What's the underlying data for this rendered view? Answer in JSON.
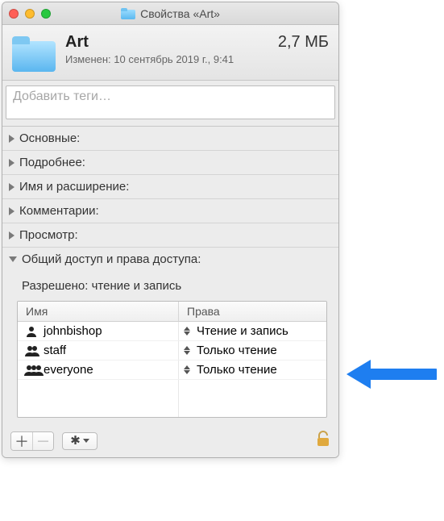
{
  "window": {
    "title": "Свойства «Art»"
  },
  "header": {
    "name": "Art",
    "size": "2,7 МБ",
    "modified": "Изменен: 10 сентябрь 2019 г., 9:41"
  },
  "tags": {
    "placeholder": "Добавить теги…"
  },
  "sections": {
    "general": "Основные:",
    "more": "Подробнее:",
    "name_ext": "Имя и расширение:",
    "comments": "Комментарии:",
    "preview": "Просмотр:",
    "sharing": "Общий доступ и права доступа:"
  },
  "sharing": {
    "allowed": "Разрешено: чтение и запись",
    "columns": {
      "name": "Имя",
      "priv": "Права"
    },
    "rows": [
      {
        "name": "johnbishop",
        "priv": "Чтение и запись",
        "kind": "user"
      },
      {
        "name": "staff",
        "priv": "Только чтение",
        "kind": "group"
      },
      {
        "name": "everyone",
        "priv": "Только чтение",
        "kind": "group"
      }
    ]
  },
  "toolbar": {
    "add": "＋",
    "remove": "－"
  }
}
